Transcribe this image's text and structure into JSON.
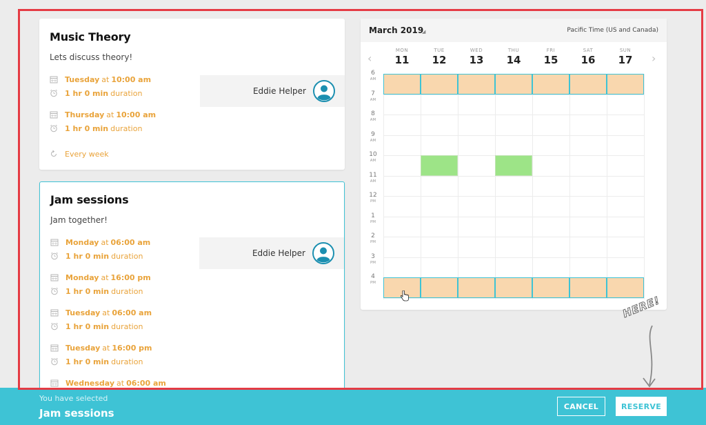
{
  "events": [
    {
      "title": "Music Theory",
      "description": "Lets discuss theory!",
      "host": "Eddie Helper",
      "slots": [
        {
          "day": "Tuesday",
          "at": "at",
          "time": "10:00 am",
          "duration": "1 hr 0 min",
          "duration_suffix": "duration"
        },
        {
          "day": "Thursday",
          "at": "at",
          "time": "10:00 am",
          "duration": "1 hr 0 min",
          "duration_suffix": "duration"
        }
      ],
      "recurrence": "Every week"
    },
    {
      "title": "Jam sessions",
      "description": "Jam together!",
      "host": "Eddie Helper",
      "slots": [
        {
          "day": "Monday",
          "at": "at",
          "time": "06:00 am",
          "duration": "1 hr 0 min",
          "duration_suffix": "duration"
        },
        {
          "day": "Monday",
          "at": "at",
          "time": "16:00 pm",
          "duration": "1 hr 0 min",
          "duration_suffix": "duration"
        },
        {
          "day": "Tuesday",
          "at": "at",
          "time": "06:00 am",
          "duration": "1 hr 0 min",
          "duration_suffix": "duration"
        },
        {
          "day": "Tuesday",
          "at": "at",
          "time": "16:00 pm",
          "duration": "1 hr 0 min",
          "duration_suffix": "duration"
        },
        {
          "day": "Wednesday",
          "at": "at",
          "time": "06:00 am"
        }
      ]
    }
  ],
  "calendar": {
    "month": "March 2019",
    "timezone": "Pacific Time (US and Canada)",
    "days": [
      {
        "dow": "MON",
        "num": "11"
      },
      {
        "dow": "TUE",
        "num": "12"
      },
      {
        "dow": "WED",
        "num": "13"
      },
      {
        "dow": "THU",
        "num": "14"
      },
      {
        "dow": "FRI",
        "num": "15"
      },
      {
        "dow": "SAT",
        "num": "16"
      },
      {
        "dow": "SUN",
        "num": "17"
      }
    ],
    "hours": [
      {
        "h": "6",
        "ap": "AM"
      },
      {
        "h": "7",
        "ap": "AM"
      },
      {
        "h": "8",
        "ap": "AM"
      },
      {
        "h": "9",
        "ap": "AM"
      },
      {
        "h": "10",
        "ap": "AM"
      },
      {
        "h": "11",
        "ap": "AM"
      },
      {
        "h": "12",
        "ap": "PM"
      },
      {
        "h": "1",
        "ap": "PM"
      },
      {
        "h": "2",
        "ap": "PM"
      },
      {
        "h": "3",
        "ap": "PM"
      },
      {
        "h": "4",
        "ap": "PM"
      }
    ]
  },
  "annotation": "HERE!",
  "footer": {
    "label": "You have selected",
    "selected": "Jam sessions",
    "cancel": "CANCEL",
    "reserve": "RESERVE"
  },
  "colors": {
    "accent": "#3ec3d5",
    "time_text": "#e9a33a",
    "busy_slot": "#f9d7ae",
    "free_slot": "#9de487",
    "highlight_frame": "#e53b44"
  },
  "icons": {
    "date": "calendar-icon",
    "duration": "alarm-clock-icon",
    "recurrence": "repeat-icon",
    "host": "user-avatar-icon",
    "prev": "chevron-left-icon",
    "next": "chevron-right-icon"
  }
}
